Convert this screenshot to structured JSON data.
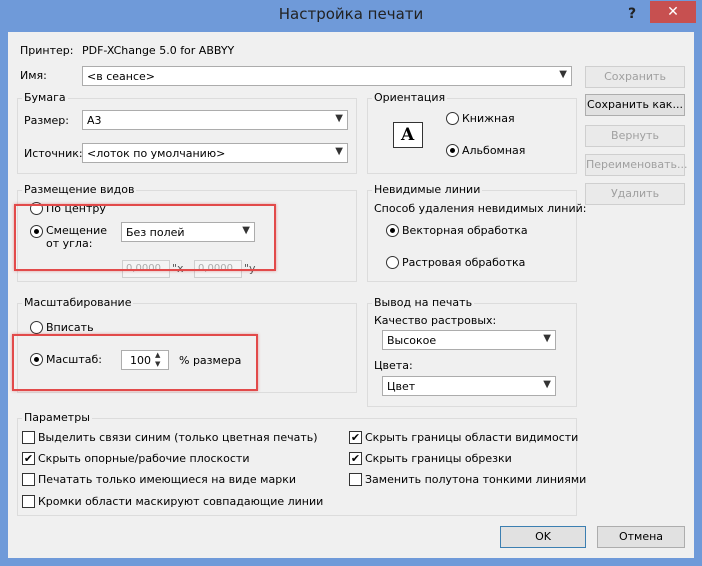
{
  "window": {
    "title": "Настройка печати",
    "help": "?",
    "close": "✕"
  },
  "printer": {
    "label": "Принтер:",
    "value": "PDF-XChange 5.0 for ABBYY"
  },
  "name": {
    "label": "Имя:",
    "value": "<в сеансе>"
  },
  "side_buttons": {
    "save": "Сохранить",
    "save_as": "Сохранить как...",
    "revert": "Вернуть",
    "rename": "Переименовать...",
    "delete": "Удалить"
  },
  "paper": {
    "title": "Бумага",
    "size_label": "Размер:",
    "size_value": "A3",
    "source_label": "Источник:",
    "source_value": "<лоток по умолчанию>"
  },
  "orientation": {
    "title": "Ориентация",
    "icon_letter": "A",
    "portrait": "Книжная",
    "landscape": "Альбомная",
    "selected": "landscape"
  },
  "view_placement": {
    "title": "Размещение видов",
    "center": "По центру",
    "offset": "Смещение от угла:",
    "offset_value": "Без полей",
    "x_value": "0,0000",
    "x_suffix": "\"x",
    "y_value": "0,0000",
    "y_suffix": "\"y",
    "selected": "offset"
  },
  "hidden_lines": {
    "title": "Невидимые линии",
    "method_label": "Способ удаления невидимых линий:",
    "vector": "Векторная обработка",
    "raster": "Растровая обработка",
    "selected": "vector"
  },
  "scaling": {
    "title": "Масштабирование",
    "fit": "Вписать",
    "scale": "Масштаб:",
    "scale_value": "100",
    "percent_label": "% размера",
    "selected": "scale"
  },
  "output": {
    "title": "Вывод на печать",
    "raster_quality_label": "Качество растровых:",
    "raster_quality_value": "Высокое",
    "colors_label": "Цвета:",
    "colors_value": "Цвет"
  },
  "params": {
    "title": "Параметры",
    "left": [
      {
        "label": "Выделить связи синим (только цветная печать)",
        "checked": false
      },
      {
        "label": "Скрыть опорные/рабочие плоскости",
        "checked": true
      },
      {
        "label": "Печатать только имеющиеся на виде марки",
        "checked": false
      },
      {
        "label": "Кромки области маскируют совпадающие линии",
        "checked": false
      }
    ],
    "right": [
      {
        "label": "Скрыть границы области видимости",
        "checked": true
      },
      {
        "label": "Скрыть границы обрезки",
        "checked": true
      },
      {
        "label": "Заменить полутона тонкими линиями",
        "checked": false
      }
    ]
  },
  "footer": {
    "ok": "OK",
    "cancel": "Отмена"
  },
  "colors": {
    "frame": "#6f9ad9",
    "close_button": "#c75050",
    "highlight": "#e24a4a"
  }
}
